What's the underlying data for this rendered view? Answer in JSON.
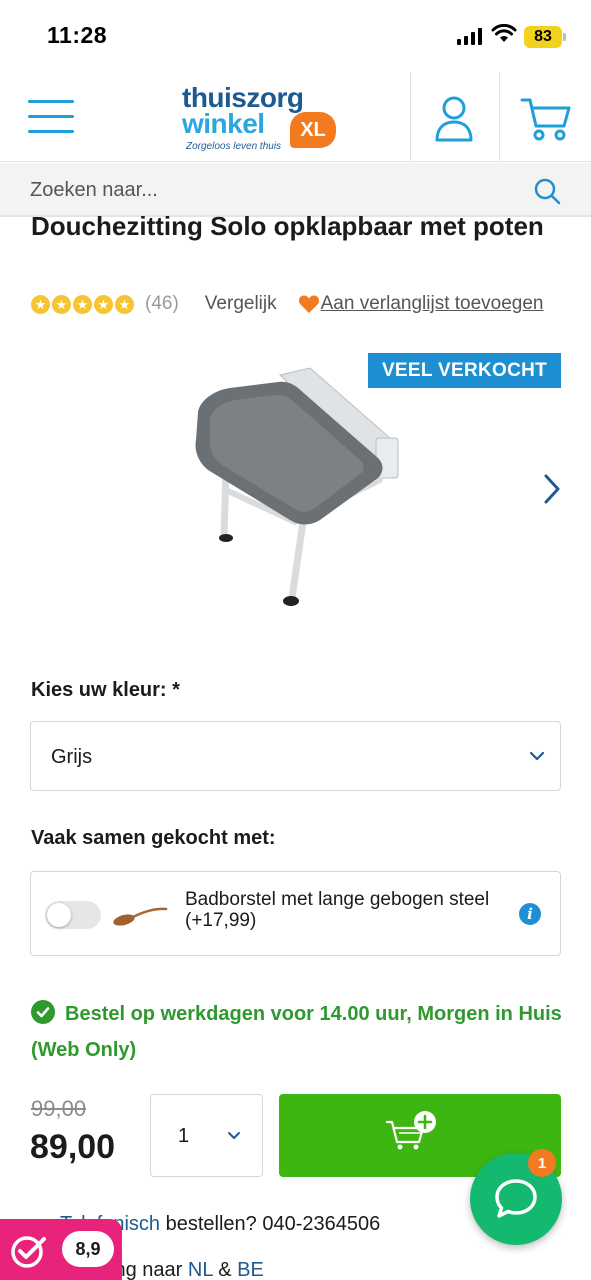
{
  "status_bar": {
    "time": "11:28",
    "battery": "83"
  },
  "header": {
    "logo_line1": "thuiszorg",
    "logo_line2": "winkel",
    "logo_xl": "XL",
    "logo_tagline": "Zorgeloos leven thuis"
  },
  "search": {
    "placeholder": "Zoeken naar..."
  },
  "product": {
    "title": "Douchezitting Solo opklapbaar met poten",
    "rating_stars": 5,
    "review_count": "(46)",
    "compare_label": "Vergelijk",
    "wishlist_label": "Aan verlanglijst toevoegen",
    "badge": "VEEL VERKOCHT"
  },
  "color_option": {
    "label": "Kies uw kleur: *",
    "selected": "Grijs"
  },
  "bought_together": {
    "label": "Vaak samen gekocht met:",
    "item_name": "Badborstel met lange gebogen steel (+17,99)",
    "toggle_on": false
  },
  "delivery": {
    "text": "Bestel op werkdagen voor 14.00 uur, Morgen in Huis (Web Only)"
  },
  "pricing": {
    "old_price": "99,00",
    "price": "89,00",
    "quantity": "1"
  },
  "chat": {
    "badge_count": "1"
  },
  "footer_lines": {
    "phone_link": "Telefonisch",
    "phone_text": " bestellen? 040-2364506",
    "ship_prefix": "Levering naar ",
    "ship_nl": "NL",
    "ship_and": " & ",
    "ship_be": "BE"
  },
  "kiyoh": {
    "score": "8,9"
  },
  "colors": {
    "brand_blue": "#1e5a92",
    "accent_blue": "#1f8fd4",
    "orange": "#f47a20",
    "green": "#3eb612",
    "chat_green": "#14b86f",
    "kiyoh_pink": "#e8237b"
  }
}
